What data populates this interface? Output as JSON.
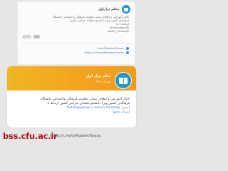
{
  "top_card": {
    "channel_name": "معلم ترازاول",
    "description_lines": [
      "کانال آموزشی و اطلاع رسانی معاونت فرهنگی و اجتماعی دانشگاه",
      "فرهنگیان کشور ویژه دانشجو معلمان سراسر کشور",
      "ارتباط با ما",
      "@farhangiyan",
      "@admin_taraze"
    ],
    "link_lines": [
      "t.me/MoalemTaraze",
      "https://t.me/s/MoalemTaraze"
    ]
  },
  "main_card": {
    "channel_name": "معلم تراز اول",
    "subtitle": "مشترک ۳۷۳۰",
    "description_lines": [
      "کانال آموزشی و اطلاع رسانی معاونت فرهنگی واجتماعی دانشگاه",
      "فرهنگیان کشور ویژه دانشجو معلمان سراسر کشور ارتباط با",
      "ادمین: @admin_taraze ما @farhangiyan",
      "ارسال محتوا"
    ]
  },
  "footer": {
    "brand": "bss.cfu.ac.ir",
    "url": "https://t.me/s/MoalemTaraze"
  },
  "colors": {
    "banner": "#f3a31e",
    "logo": "#2596c8",
    "link": "#3a7cc0",
    "brand": "#b0151a"
  }
}
